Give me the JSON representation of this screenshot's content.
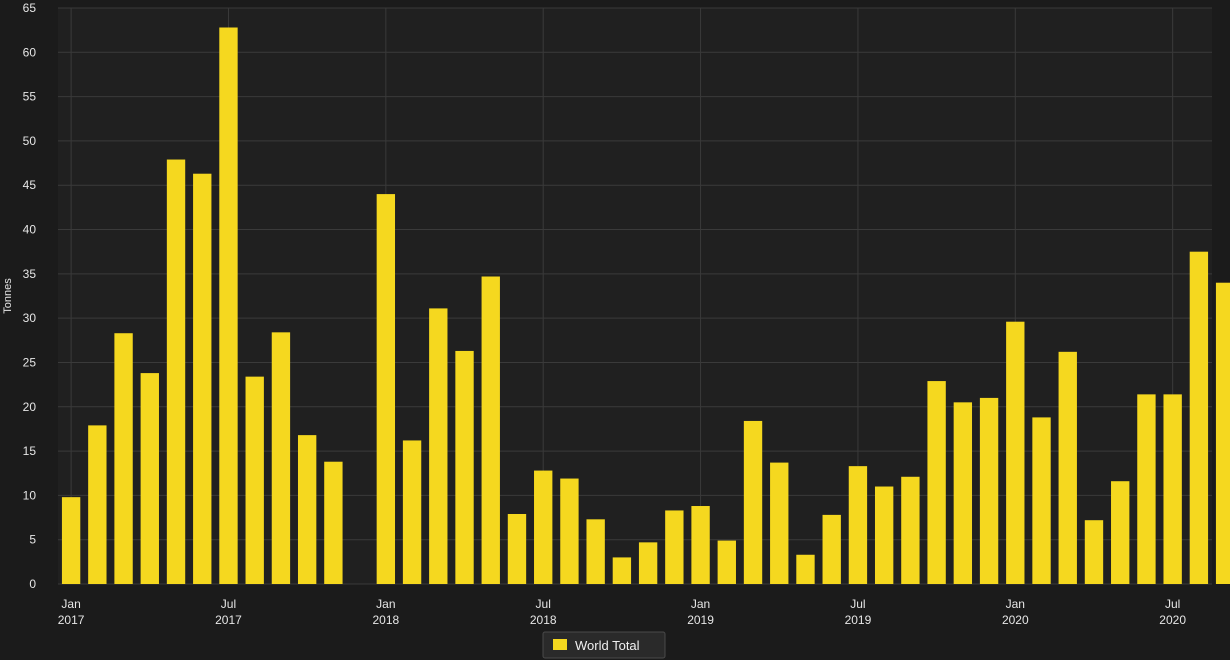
{
  "chart_data": {
    "type": "bar",
    "title": "",
    "xlabel": "",
    "ylabel": "Tonnes",
    "ylim": [
      0,
      65
    ],
    "yticks": [
      0,
      5,
      10,
      15,
      20,
      25,
      30,
      35,
      40,
      45,
      50,
      55,
      60,
      65
    ],
    "grid": true,
    "legend_position": "bottom-center",
    "colors": {
      "background": "#1b1b1b",
      "plot": "#202020",
      "grid": "#3a3a3a",
      "bar": "#f5d81f",
      "text": "#e6e6e6"
    },
    "x_tick_labels": [
      {
        "index": 0,
        "month": "Jan",
        "year": "2017"
      },
      {
        "index": 6,
        "month": "Jul",
        "year": "2017"
      },
      {
        "index": 12,
        "month": "Jan",
        "year": "2018"
      },
      {
        "index": 18,
        "month": "Jul",
        "year": "2018"
      },
      {
        "index": 24,
        "month": "Jan",
        "year": "2019"
      },
      {
        "index": 30,
        "month": "Jul",
        "year": "2019"
      },
      {
        "index": 36,
        "month": "Jan",
        "year": "2020"
      },
      {
        "index": 42,
        "month": "Jul",
        "year": "2020"
      }
    ],
    "categories": [
      "2017-01",
      "2017-02",
      "2017-03",
      "2017-04",
      "2017-05",
      "2017-06",
      "2017-07",
      "2017-08",
      "2017-09",
      "2017-10",
      "2017-11",
      "2017-12",
      "2018-01",
      "2018-02",
      "2018-03",
      "2018-04",
      "2018-05",
      "2018-06",
      "2018-07",
      "2018-08",
      "2018-09",
      "2018-10",
      "2018-11",
      "2018-12",
      "2019-01",
      "2019-02",
      "2019-03",
      "2019-04",
      "2019-05",
      "2019-06",
      "2019-07",
      "2019-08",
      "2019-09",
      "2019-10",
      "2019-11",
      "2019-12",
      "2020-01",
      "2020-02",
      "2020-03",
      "2020-04",
      "2020-05",
      "2020-06",
      "2020-07",
      "2020-08"
    ],
    "series": [
      {
        "name": "World Total",
        "values": [
          9.8,
          17.9,
          28.3,
          23.8,
          47.9,
          46.3,
          62.8,
          23.4,
          28.4,
          16.8,
          13.8,
          0,
          44.0,
          16.2,
          31.1,
          26.3,
          34.7,
          7.9,
          12.8,
          11.9,
          7.3,
          3.0,
          4.7,
          8.3,
          8.8,
          4.9,
          18.4,
          13.7,
          3.3,
          7.8,
          13.3,
          11.0,
          12.1,
          22.9,
          20.5,
          21.0,
          29.6,
          18.8,
          26.2,
          7.2,
          11.6,
          21.4,
          21.4,
          37.5,
          34.0
        ]
      }
    ]
  }
}
